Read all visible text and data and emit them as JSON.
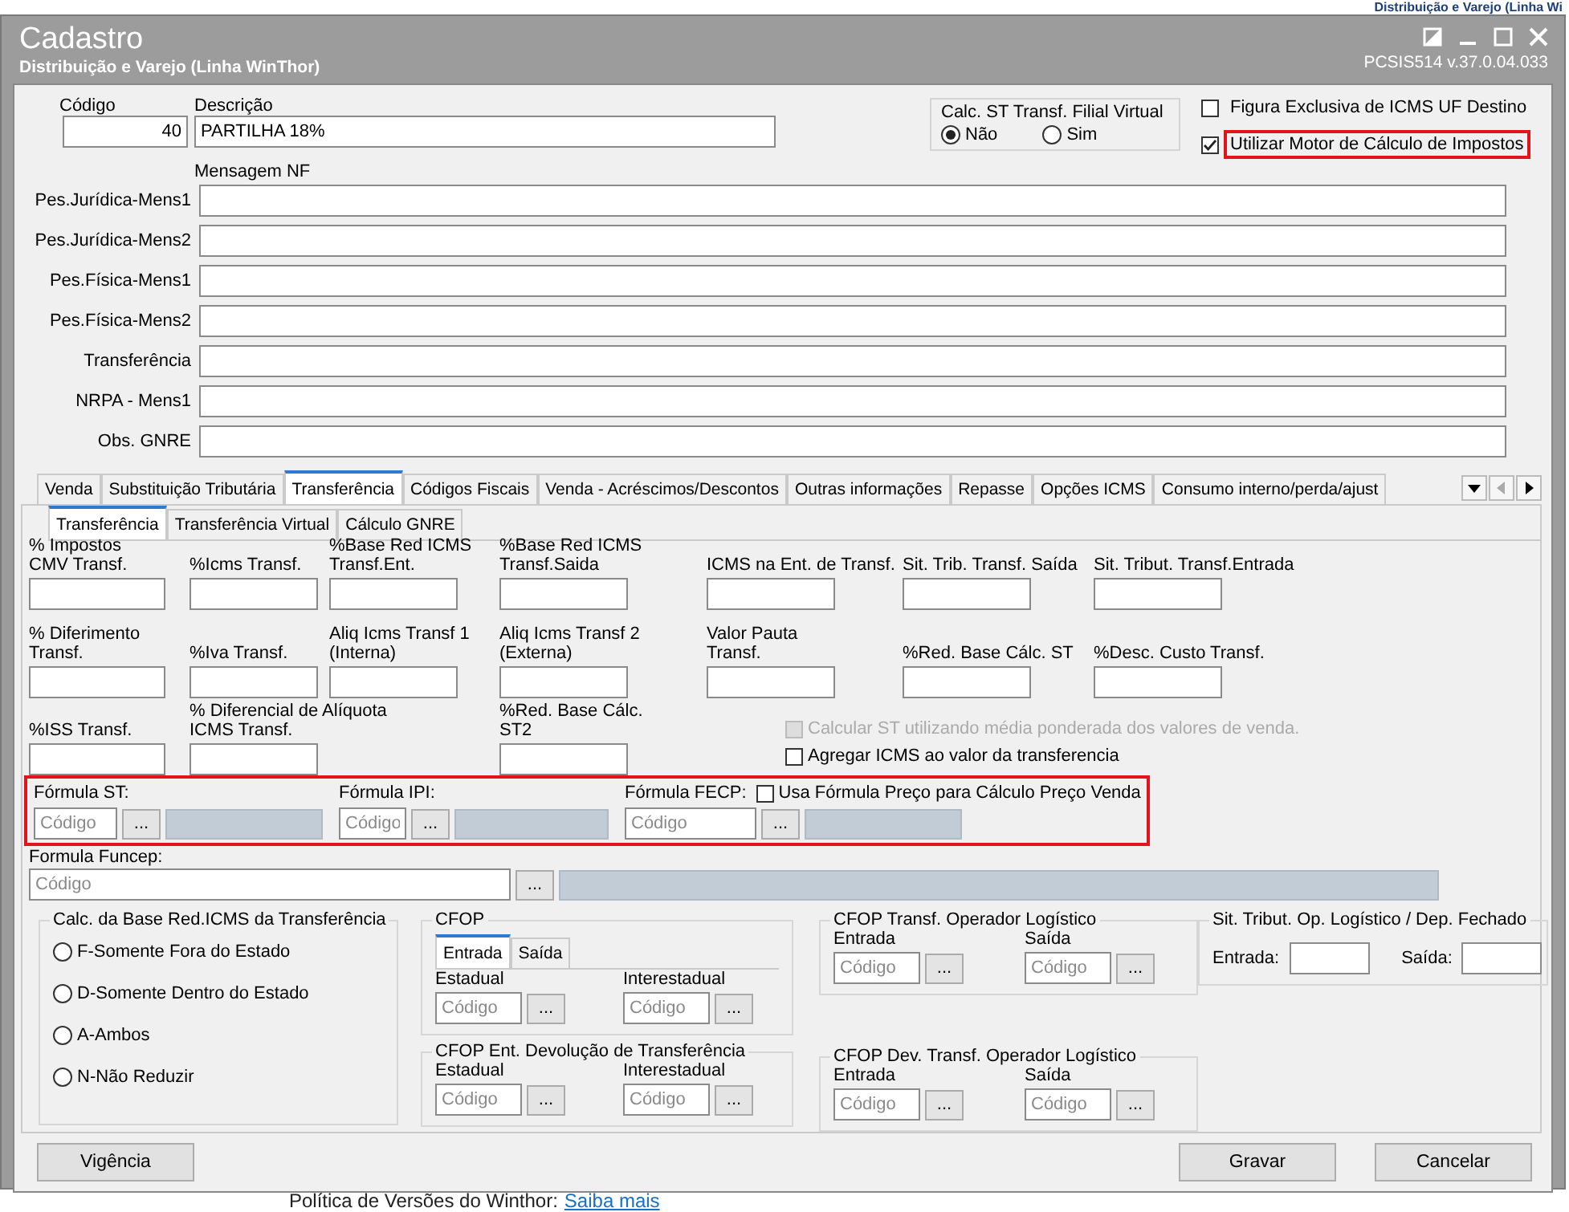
{
  "backdrop": {
    "header_text": "Distribuição e Varejo (Linha Wi",
    "footer_text": "Política de Versões do Winthor:",
    "footer_link": "Saiba mais"
  },
  "window": {
    "title": "Cadastro",
    "subtitle": "Distribuição e Varejo (Linha WinThor)",
    "version": "PCSIS514  v.37.0.04.033"
  },
  "header": {
    "codigo": {
      "label": "Código",
      "value": "40"
    },
    "descricao": {
      "label": "Descrição",
      "value": "PARTILHA 18%"
    },
    "calc_st": {
      "title": "Calc. ST Transf. Filial Virtual",
      "options": [
        {
          "label": "Não",
          "selected": true
        },
        {
          "label": "Sim",
          "selected": false
        }
      ]
    },
    "options": [
      {
        "label": "Figura Exclusiva de ICMS UF Destino",
        "checked": false,
        "highlighted": false
      },
      {
        "label": "Utilizar Motor de Cálculo de Impostos",
        "checked": true,
        "highlighted": true
      }
    ]
  },
  "mensagem_nf": {
    "title": "Mensagem NF",
    "rows": [
      "Pes.Jurídica-Mens1",
      "Pes.Jurídica-Mens2",
      "Pes.Física-Mens1",
      "Pes.Física-Mens2",
      "Transferência",
      "NRPA - Mens1",
      "Obs. GNRE"
    ]
  },
  "main_tabs": [
    {
      "label": "Venda",
      "selected": false
    },
    {
      "label": "Substituição Tributária",
      "selected": false
    },
    {
      "label": "Transferência",
      "selected": true
    },
    {
      "label": "Códigos Fiscais",
      "selected": false
    },
    {
      "label": "Venda - Acréscimos/Descontos",
      "selected": false
    },
    {
      "label": "Outras informações",
      "selected": false
    },
    {
      "label": "Repasse",
      "selected": false
    },
    {
      "label": "Opções ICMS",
      "selected": false
    },
    {
      "label": "Consumo interno/perda/ajust",
      "selected": false
    }
  ],
  "sub_tabs": [
    {
      "label": "Transferência",
      "selected": true
    },
    {
      "label": "Transferência Virtual",
      "selected": false
    },
    {
      "label": "Cálculo GNRE",
      "selected": false
    }
  ],
  "field_rows": [
    [
      "% Impostos\nCMV Transf.",
      "%Icms Transf.",
      "%Base Red ICMS\nTransf.Ent.",
      "%Base Red ICMS\nTransf.Saida",
      "ICMS na Ent. de Transf.",
      "Sit. Trib. Transf. Saída",
      "Sit. Tribut. Transf.Entrada"
    ],
    [
      "% Diferimento\nTransf.",
      "%Iva Transf.",
      "Aliq Icms Transf 1\n(Interna)",
      "Aliq Icms Transf 2\n(Externa)",
      "Valor Pauta\nTransf.",
      "%Red. Base Cálc. ST",
      "%Desc. Custo Transf."
    ],
    [
      "%ISS  Transf.",
      "% Diferencial de Alíquota\nICMS Transf.",
      "%Red. Base Cálc. ST2"
    ]
  ],
  "checkboxes": [
    {
      "label": "Calcular ST utilizando média ponderada dos valores de venda.",
      "checked": false,
      "disabled": true
    },
    {
      "label": "Agregar ICMS ao valor da transferencia",
      "checked": false,
      "disabled": false
    },
    {
      "label": "Usa Fórmula Preço para Cálculo Preço Venda",
      "checked": false,
      "disabled": false
    }
  ],
  "formulas": {
    "highlighted": true,
    "items": [
      {
        "label": "Fórmula ST:",
        "placeholder": "Código",
        "button": "..."
      },
      {
        "label": "Fórmula IPI:",
        "placeholder": "Código",
        "button": "..."
      },
      {
        "label": "Fórmula FECP:",
        "placeholder": "Código",
        "button": "..."
      }
    ]
  },
  "funcep": {
    "label": "Formula Funcep:",
    "placeholder": "Código",
    "button": "..."
  },
  "base_red": {
    "title": "Calc. da Base Red.ICMS da Transferência",
    "options": [
      {
        "label": "F-Somente Fora do Estado",
        "selected": false
      },
      {
        "label": "D-Somente Dentro do Estado",
        "selected": false
      },
      {
        "label": "A-Ambos",
        "selected": false
      },
      {
        "label": "N-Não Reduzir",
        "selected": false
      }
    ]
  },
  "cfop": {
    "title": "CFOP",
    "tabs": [
      {
        "label": "Entrada",
        "selected": true
      },
      {
        "label": "Saída",
        "selected": false
      }
    ],
    "fields": [
      {
        "label": "Estadual",
        "placeholder": "Código",
        "button": "..."
      },
      {
        "label": "Interestadual",
        "placeholder": "Código",
        "button": "..."
      }
    ]
  },
  "cfop_dev": {
    "title": "CFOP Ent. Devolução de Transferência",
    "fields": [
      {
        "label": "Estadual",
        "placeholder": "Código",
        "button": "..."
      },
      {
        "label": "Interestadual",
        "placeholder": "Código",
        "button": "..."
      }
    ]
  },
  "cfop_op": {
    "title": "CFOP Transf. Operador Logístico",
    "fields": [
      {
        "label": "Entrada",
        "placeholder": "Código",
        "button": "..."
      },
      {
        "label": "Saída",
        "placeholder": "Código",
        "button": "..."
      }
    ]
  },
  "cfop_dev_op": {
    "title": "CFOP Dev. Transf. Operador Logístico",
    "fields": [
      {
        "label": "Entrada",
        "placeholder": "Código",
        "button": "..."
      },
      {
        "label": "Saída",
        "placeholder": "Código",
        "button": "..."
      }
    ]
  },
  "sit_trib": {
    "title": "Sit. Tribut. Op. Logístico / Dep. Fechado",
    "fields": [
      {
        "label": "Entrada:"
      },
      {
        "label": "Saída:"
      }
    ]
  },
  "buttons": [
    "Vigência",
    "Gravar",
    "Cancelar"
  ]
}
